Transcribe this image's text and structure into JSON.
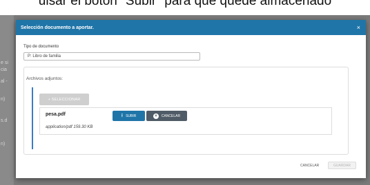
{
  "caption": "ulsar el botón \"Subir\" para que quede almacenado",
  "background": {
    "fragments": [
      "e si",
      "cia",
      "al -",
      "n)",
      "s.d",
      "n)"
    ]
  },
  "modal": {
    "title": "Selección documento a aportar.",
    "close_glyph": "×",
    "doc_type_label": "Tipo de documento",
    "doc_type_value": "P: Libro de familia",
    "attachments_label": "Archivos adjuntos:",
    "select_button": "+ SELECCIONAR",
    "file": {
      "name": "pesa.pdf",
      "meta": "application/pdf 159.30 KB"
    },
    "upload_button": "SUBIR",
    "cancel_button": "CANCELAR",
    "footer_cancel": "CANCELAR",
    "footer_save": "GUARDAR"
  },
  "colors": {
    "accent": "#1f75a8",
    "cancel_button": "#4f5b66",
    "left_accent_bar": "#3a7bc4"
  },
  "icons": {
    "close": "close-icon",
    "upload": "upload-icon",
    "cancel": "cancel-icon"
  }
}
